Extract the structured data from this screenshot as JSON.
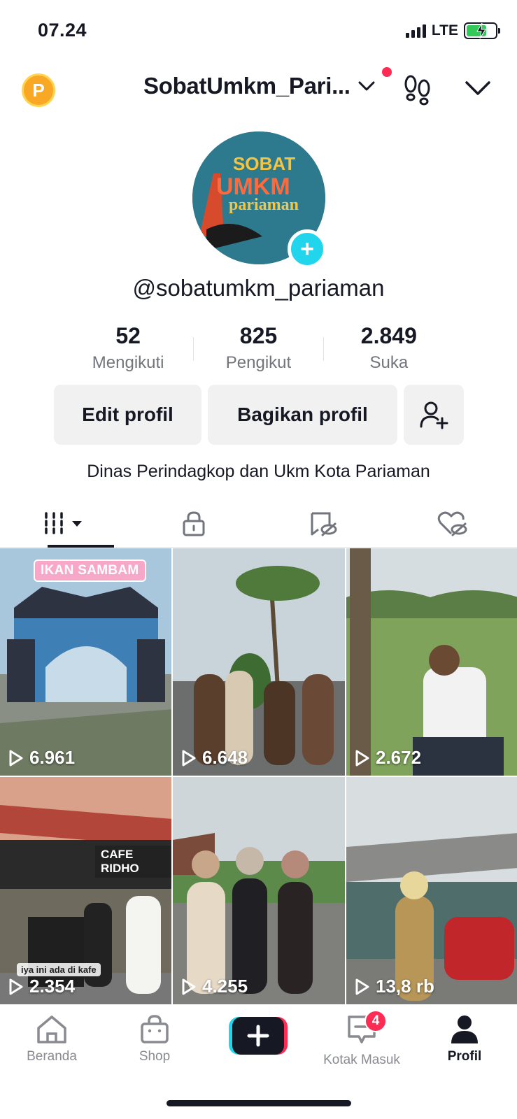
{
  "status_bar": {
    "time": "07.24",
    "network": "LTE"
  },
  "header": {
    "coin_letter": "P",
    "username": "SobatUmkm_Pari...",
    "has_notification_dot": true
  },
  "profile": {
    "handle": "@sobatumkm_pariaman",
    "avatar_text": [
      "SOBAT",
      "UMKM",
      "pariaman"
    ],
    "stats": [
      {
        "value": "52",
        "label": "Mengikuti"
      },
      {
        "value": "825",
        "label": "Pengikut"
      },
      {
        "value": "2.849",
        "label": "Suka"
      }
    ],
    "edit_label": "Edit profil",
    "share_label": "Bagikan profil",
    "bio": "Dinas Perindagkop dan Ukm Kota Pariaman"
  },
  "tabs": [
    "videos-tab",
    "private-tab",
    "reposts-hidden-tab",
    "liked-hidden-tab"
  ],
  "videos": [
    {
      "views": "6.961",
      "caption": "IKAN SAMBAM",
      "scene": "gate"
    },
    {
      "views": "6.648",
      "caption": "",
      "scene": "street-group"
    },
    {
      "views": "2.672",
      "caption": "",
      "scene": "field"
    },
    {
      "views": "2.354",
      "caption": "iya ini ada di kafe",
      "sign": "CAFE RIDHO",
      "scene": "cafe"
    },
    {
      "views": "4.255",
      "caption": "",
      "scene": "walk"
    },
    {
      "views": "13,8 rb",
      "caption": "",
      "scene": "shop"
    }
  ],
  "bottom_nav": {
    "home": "Beranda",
    "shop": "Shop",
    "inbox": "Kotak Masuk",
    "inbox_badge": "4",
    "profile": "Profil"
  },
  "colors": {
    "accent_red": "#fe2c55",
    "accent_cyan": "#20d5ec",
    "text": "#161823",
    "muted": "#73757c"
  }
}
